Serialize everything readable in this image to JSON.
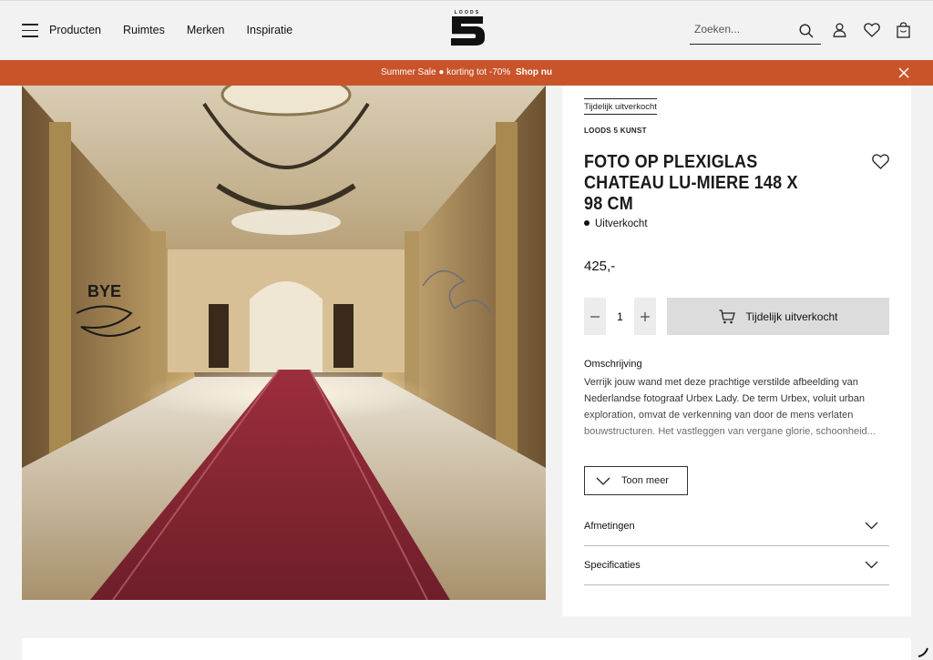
{
  "header": {
    "nav": [
      "Producten",
      "Ruimtes",
      "Merken",
      "Inspiratie"
    ],
    "logo_text": "LOODS",
    "logo_number": "5",
    "search_placeholder": "Zoeken..."
  },
  "banner": {
    "text": "Summer Sale ● korting tot -70%",
    "link": "Shop nu",
    "color": "#c9542a"
  },
  "product": {
    "badge": "Tijdelijk uitverkocht",
    "brand": "LOODS 5 KUNST",
    "title": "Foto op plexiglas Chateau Lu-miere 148 x 98 cm",
    "stock": "Uitverkocht",
    "price": "425,-",
    "quantity": "1",
    "cart_button": "Tijdelijk uitverkocht",
    "description_title": "Omschrijving",
    "description": "Verrijk jouw wand met deze prachtige verstilde afbeelding van Nederlandse fotograaf Urbex Lady. De term Urbex, voluit urban exploration, omvat de verkenning van door de mens verlaten bouwstructuren. Het vastleggen van vergane glorie, schoonheid...",
    "more_button": "Toon meer",
    "accordions": [
      "Afmetingen",
      "Specificaties"
    ]
  },
  "icons": {
    "menu": "hamburger-icon",
    "search": "search-icon",
    "account": "user-icon",
    "wishlist": "heart-icon",
    "cart": "bag-icon",
    "close": "close-icon",
    "chevron": "chevron-down-icon"
  }
}
